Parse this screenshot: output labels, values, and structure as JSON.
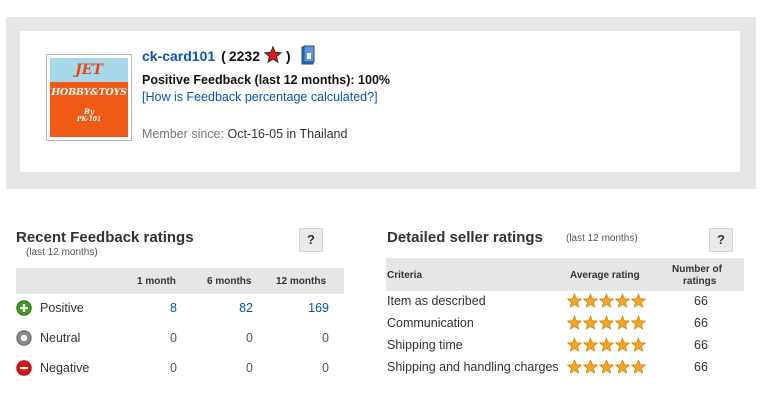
{
  "seller": {
    "logo": {
      "line1": "JET",
      "line2": "HOBBY&TOYS",
      "line3": "By",
      "line4": "PK-101"
    },
    "name": "ck-card101",
    "open_paren": "(",
    "score": "2232",
    "close_paren": ")",
    "positive_feedback": "Positive Feedback (last 12 months): 100%",
    "how_calculated_link": "[How is Feedback percentage calculated?]",
    "member_since_label": "Member since:",
    "member_since_value": "Oct-16-05 in Thailand"
  },
  "recent_feedback": {
    "title": "Recent Feedback ratings",
    "subtitle": "(last 12 months)",
    "help": "?",
    "columns": [
      "1 month",
      "6 months",
      "12 months"
    ],
    "rows": [
      {
        "label": "Positive",
        "icon": "positive-plus-icon",
        "color": "#3b9c1f",
        "values": [
          "8",
          "82",
          "169"
        ]
      },
      {
        "label": "Neutral",
        "icon": "neutral-circle-icon",
        "color": "#8a8a8a",
        "values": [
          "0",
          "0",
          "0"
        ]
      },
      {
        "label": "Negative",
        "icon": "negative-minus-icon",
        "color": "#d7141a",
        "values": [
          "0",
          "0",
          "0"
        ]
      }
    ]
  },
  "detailed_ratings": {
    "title": "Detailed seller ratings",
    "subtitle": "(last 12 months)",
    "help": "?",
    "columns": {
      "criteria": "Criteria",
      "average": "Average rating",
      "number_line1": "Number of",
      "number_line2": "ratings"
    },
    "rows": [
      {
        "criteria": "Item as described",
        "stars": 5,
        "count": "66"
      },
      {
        "criteria": "Communication",
        "stars": 5,
        "count": "66"
      },
      {
        "criteria": "Shipping time",
        "stars": 5,
        "count": "66"
      },
      {
        "criteria": "Shipping and handling charges",
        "stars": 5,
        "count": "66"
      }
    ]
  },
  "colors": {
    "link": "#0654ba",
    "star_gold": "#f5a623",
    "header_bar": "#e6e6e6"
  }
}
